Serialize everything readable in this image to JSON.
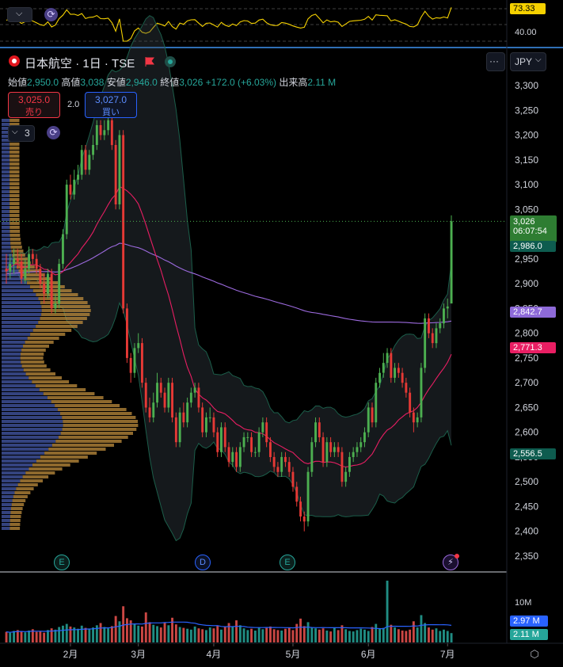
{
  "header": {
    "symbol": "日本航空",
    "interval": "1日",
    "exchange": "TSE",
    "separator": "·",
    "currency": "JPY",
    "more_label": "···"
  },
  "ohlc": {
    "open_label": "始値",
    "open": "2,950.0",
    "high_label": "高値",
    "high": "3,038",
    "low_label": "安値",
    "low": "2,946.0",
    "close_label": "終値",
    "close": "3,026",
    "change": "+172.0 (+6.03%)",
    "volume_label": "出来高",
    "volume": "2.11 M"
  },
  "trade": {
    "sell_price": "3,025.0",
    "sell_label": "売り",
    "spread": "2.0",
    "buy_price": "3,027.0",
    "buy_label": "買い"
  },
  "indicators": {
    "count": "3"
  },
  "top_pane": {
    "rsi_value": "73.33",
    "rsi_level": "40.00"
  },
  "price_axis": {
    "ticks": [
      "3,300",
      "3,250",
      "3,200",
      "3,150",
      "3,100",
      "3,050",
      "2,950",
      "2,900",
      "2,850",
      "2,800",
      "2,750",
      "2,700",
      "2,650",
      "2,600",
      "2,550",
      "2,500",
      "2,450",
      "2,400",
      "2,350"
    ],
    "last_price": "3,026",
    "countdown": "06:07:54",
    "bb_upper": "2,986.0",
    "sma200": "2,842.7",
    "sma20": "2,771.3",
    "bb_lower": "2,556.5"
  },
  "volume_axis": {
    "tick": "10M",
    "avg": "2.97 M",
    "last": "2.11 M"
  },
  "time_axis": {
    "labels": [
      "2月",
      "3月",
      "4月",
      "5月",
      "6月",
      "7月"
    ]
  },
  "events": {
    "earnings_1": "E",
    "dividend": "D",
    "earnings_2": "E"
  },
  "colors": {
    "up": "#26a69a",
    "down": "#ef5350",
    "candle_up": "#4caf50",
    "candle_down": "#e53935",
    "sma20": "#e91e63",
    "sma200": "#9c6ade",
    "bb_band": "#1b5e4a",
    "rsi": "#f5d100"
  },
  "chart_data": {
    "type": "candlestick",
    "ylim": [
      2320,
      3330
    ],
    "x": [
      "1/8",
      "1/9",
      "1/10",
      "1/14",
      "1/15",
      "1/16",
      "1/17",
      "1/20",
      "1/21",
      "1/22",
      "1/23",
      "1/24",
      "1/27",
      "1/28",
      "1/29",
      "1/30",
      "1/31",
      "2/3",
      "2/4",
      "2/5",
      "2/6",
      "2/7",
      "2/10",
      "2/12",
      "2/13",
      "2/14",
      "2/17",
      "2/18",
      "2/19",
      "2/20",
      "2/21",
      "2/25",
      "2/26",
      "2/27",
      "2/28",
      "3/3",
      "3/4",
      "3/5",
      "3/6",
      "3/7",
      "3/10",
      "3/11",
      "3/12",
      "3/13",
      "3/14",
      "3/17",
      "3/18",
      "3/19",
      "3/21",
      "3/24",
      "3/25",
      "3/26",
      "3/27",
      "3/28",
      "3/31",
      "4/1",
      "4/2",
      "4/3",
      "4/4",
      "4/7",
      "4/8",
      "4/9",
      "4/10",
      "4/11",
      "4/14",
      "4/15",
      "4/16",
      "4/17",
      "4/18",
      "4/21",
      "4/22",
      "4/23",
      "4/24",
      "4/25",
      "4/28",
      "4/30",
      "5/1",
      "5/2",
      "5/7",
      "5/8",
      "5/9",
      "5/12",
      "5/13",
      "5/14",
      "5/15",
      "5/16",
      "5/19",
      "5/20",
      "5/21",
      "5/22",
      "5/23",
      "5/26",
      "5/27",
      "5/28",
      "5/29",
      "5/30",
      "6/2",
      "6/3",
      "6/4",
      "6/5",
      "6/6",
      "6/9",
      "6/10",
      "6/11",
      "6/12",
      "6/13",
      "6/16",
      "6/17",
      "6/18",
      "6/19",
      "6/20",
      "6/23",
      "6/24",
      "6/25",
      "6/26",
      "6/27",
      "6/30",
      "7/1",
      "7/2"
    ],
    "open": [
      2930,
      2925,
      2940,
      2950,
      2945,
      2910,
      2930,
      2960,
      2950,
      2930,
      2900,
      2880,
      2920,
      2850,
      2860,
      2940,
      3000,
      3100,
      3080,
      3110,
      3120,
      3170,
      3130,
      3160,
      3180,
      3220,
      3200,
      3210,
      3230,
      3180,
      3060,
      3200,
      2850,
      2750,
      2720,
      2770,
      2780,
      2700,
      2650,
      2630,
      2660,
      2700,
      2680,
      2650,
      2700,
      2630,
      2580,
      2640,
      2620,
      2660,
      2680,
      2690,
      2650,
      2600,
      2630,
      2630,
      2600,
      2560,
      2610,
      2570,
      2540,
      2560,
      2530,
      2570,
      2590,
      2590,
      2560,
      2560,
      2600,
      2620,
      2580,
      2550,
      2530,
      2520,
      2550,
      2540,
      2520,
      2490,
      2460,
      2430,
      2420,
      2520,
      2580,
      2620,
      2590,
      2540,
      2580,
      2560,
      2570,
      2560,
      2500,
      2520,
      2550,
      2560,
      2570,
      2580,
      2600,
      2650,
      2620,
      2700,
      2720,
      2740,
      2760,
      2710,
      2730,
      2720,
      2700,
      2680,
      2640,
      2620,
      2630,
      2730,
      2830,
      2800,
      2780,
      2810,
      2820,
      2850,
      2860
    ],
    "close": [
      2925,
      2940,
      2950,
      2945,
      2910,
      2930,
      2960,
      2950,
      2930,
      2900,
      2880,
      2920,
      2850,
      2860,
      2940,
      3000,
      3100,
      3080,
      3110,
      3120,
      3170,
      3130,
      3160,
      3180,
      3220,
      3200,
      3210,
      3230,
      3180,
      3060,
      3200,
      2850,
      2750,
      2720,
      2770,
      2780,
      2700,
      2650,
      2630,
      2660,
      2700,
      2680,
      2650,
      2700,
      2630,
      2580,
      2640,
      2620,
      2660,
      2680,
      2690,
      2650,
      2600,
      2630,
      2630,
      2600,
      2560,
      2610,
      2570,
      2540,
      2560,
      2530,
      2570,
      2590,
      2590,
      2560,
      2560,
      2600,
      2620,
      2580,
      2550,
      2530,
      2520,
      2550,
      2540,
      2520,
      2490,
      2460,
      2430,
      2420,
      2520,
      2580,
      2620,
      2590,
      2540,
      2580,
      2560,
      2570,
      2560,
      2500,
      2520,
      2550,
      2560,
      2570,
      2580,
      2600,
      2650,
      2620,
      2700,
      2720,
      2740,
      2760,
      2710,
      2730,
      2720,
      2700,
      2680,
      2640,
      2620,
      2630,
      2730,
      2830,
      2800,
      2780,
      2810,
      2820,
      2850,
      2854,
      3026
    ],
    "high": [
      2960,
      2960,
      2970,
      2970,
      2960,
      2950,
      2975,
      2970,
      2960,
      2940,
      2920,
      2930,
      2930,
      2880,
      2950,
      3010,
      3110,
      3120,
      3130,
      3140,
      3180,
      3180,
      3170,
      3200,
      3230,
      3230,
      3230,
      3240,
      3240,
      3190,
      3210,
      3210,
      2860,
      2760,
      2780,
      2800,
      2790,
      2710,
      2670,
      2680,
      2720,
      2710,
      2690,
      2710,
      2710,
      2640,
      2650,
      2660,
      2670,
      2690,
      2700,
      2700,
      2660,
      2640,
      2650,
      2640,
      2610,
      2620,
      2620,
      2580,
      2570,
      2570,
      2580,
      2600,
      2600,
      2600,
      2570,
      2610,
      2630,
      2630,
      2590,
      2560,
      2540,
      2560,
      2560,
      2550,
      2530,
      2500,
      2470,
      2440,
      2530,
      2590,
      2630,
      2630,
      2600,
      2590,
      2590,
      2580,
      2580,
      2570,
      2530,
      2560,
      2570,
      2580,
      2590,
      2610,
      2660,
      2660,
      2710,
      2730,
      2760,
      2770,
      2770,
      2740,
      2740,
      2730,
      2710,
      2690,
      2650,
      2640,
      2740,
      2840,
      2840,
      2810,
      2820,
      2830,
      2860,
      2870,
      3038
    ],
    "low": [
      2900,
      2910,
      2920,
      2930,
      2900,
      2900,
      2920,
      2940,
      2920,
      2890,
      2860,
      2870,
      2840,
      2840,
      2850,
      2930,
      2990,
      3070,
      3070,
      3100,
      3110,
      3120,
      3120,
      3150,
      3170,
      3190,
      3190,
      3200,
      3170,
      3050,
      3050,
      2840,
      2740,
      2700,
      2710,
      2760,
      2690,
      2640,
      2620,
      2620,
      2650,
      2670,
      2640,
      2640,
      2620,
      2570,
      2570,
      2610,
      2610,
      2650,
      2670,
      2640,
      2590,
      2590,
      2620,
      2590,
      2550,
      2550,
      2560,
      2530,
      2530,
      2520,
      2520,
      2560,
      2580,
      2550,
      2550,
      2550,
      2590,
      2570,
      2540,
      2520,
      2510,
      2510,
      2530,
      2510,
      2480,
      2450,
      2420,
      2400,
      2410,
      2510,
      2570,
      2580,
      2530,
      2530,
      2550,
      2550,
      2550,
      2490,
      2490,
      2510,
      2540,
      2550,
      2560,
      2570,
      2590,
      2610,
      2610,
      2690,
      2710,
      2730,
      2700,
      2700,
      2710,
      2690,
      2670,
      2630,
      2600,
      2610,
      2620,
      2720,
      2790,
      2770,
      2770,
      2800,
      2810,
      2830,
      2946
    ],
    "volume": [
      2.4,
      2.2,
      2.6,
      2.8,
      2.5,
      2.3,
      2.7,
      3.0,
      2.4,
      2.6,
      2.2,
      2.8,
      3.2,
      2.9,
      3.5,
      3.8,
      4.2,
      3.6,
      3.4,
      3.1,
      3.8,
      3.3,
      3.0,
      3.4,
      3.9,
      4.4,
      3.5,
      3.2,
      3.7,
      6.0,
      4.8,
      8.2,
      5.5,
      5.0,
      4.2,
      3.8,
      3.6,
      6.8,
      4.6,
      4.0,
      3.7,
      3.4,
      4.5,
      3.9,
      5.6,
      4.1,
      3.5,
      3.3,
      3.1,
      2.9,
      3.6,
      3.2,
      3.0,
      2.8,
      3.4,
      3.2,
      3.8,
      2.9,
      3.6,
      4.4,
      3.6,
      5.0,
      3.9,
      3.2,
      2.8,
      3.1,
      2.7,
      3.4,
      3.0,
      3.3,
      3.6,
      3.0,
      2.8,
      2.7,
      3.1,
      3.3,
      2.8,
      4.2,
      5.4,
      3.7,
      4.6,
      3.4,
      3.2,
      2.9,
      3.2,
      2.7,
      2.5,
      3.4,
      2.8,
      3.9,
      3.0,
      2.6,
      2.5,
      2.8,
      3.1,
      2.9,
      2.6,
      3.5,
      4.2,
      3.1,
      3.3,
      14.0,
      4.0,
      3.4,
      3.0,
      2.7,
      2.6,
      2.9,
      4.8,
      3.4,
      6.2,
      4.4,
      3.4,
      2.9,
      3.2,
      2.6,
      2.9,
      2.6,
      2.11
    ],
    "volume_avg": "2.97 M"
  }
}
